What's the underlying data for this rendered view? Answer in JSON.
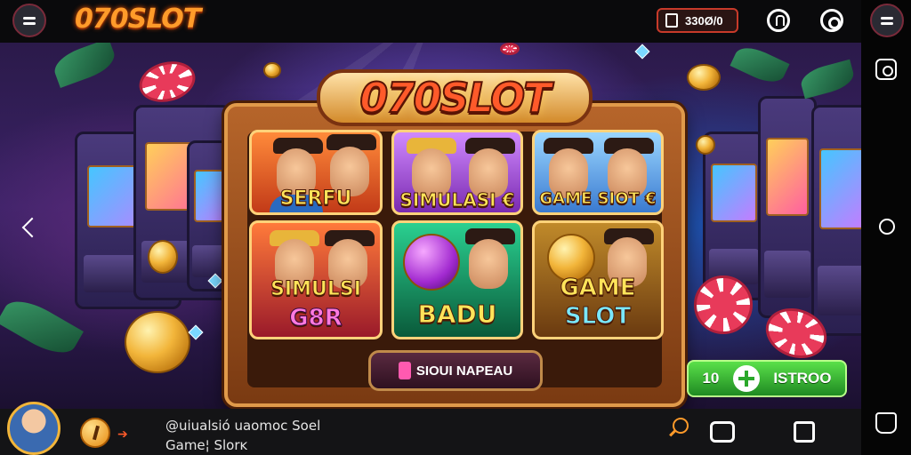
{
  "topbar": {
    "brand": "070SLOT",
    "balance": "330Ø/0",
    "icons": [
      "menu-icon",
      "wallet-icon",
      "gift-icon",
      "settings-icon"
    ]
  },
  "game": {
    "logo": "070SLOT",
    "tiles": [
      {
        "label": "SERFU"
      },
      {
        "label": "SIMULASI €"
      },
      {
        "label": "GAME SIOT €"
      },
      {
        "label_line1": "SIMULSI",
        "label_line2": "G8R"
      },
      {
        "label": "BADU"
      },
      {
        "label_line1": "GAME",
        "label_line2": "SLOT"
      }
    ],
    "center_button": "SIOUI NAPEAU",
    "green_button_left": "10",
    "green_button_right": "ISTROO"
  },
  "bottombar": {
    "line1": "@uiualsió uaomoc Soel",
    "line2": "Game¦ Slorĸ"
  },
  "sidebar": {
    "icons": [
      "menu-icon",
      "camera-icon",
      "home-circle-icon",
      "controller-icon"
    ]
  }
}
